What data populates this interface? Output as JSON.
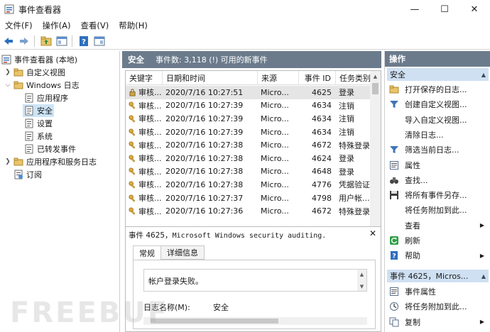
{
  "window": {
    "title": "事件查看器",
    "controls": {
      "minimize": "—",
      "maximize": "☐",
      "close": "✕"
    }
  },
  "menubar": [
    "文件(F)",
    "操作(A)",
    "查看(V)",
    "帮助(H)"
  ],
  "tree": {
    "root": "事件查看器 (本地)",
    "custom_views": "自定义视图",
    "windows_logs": "Windows 日志",
    "logs": [
      "应用程序",
      "安全",
      "设置",
      "系统",
      "已转发事件"
    ],
    "apps_services": "应用程序和服务日志",
    "subscriptions": "订阅"
  },
  "center": {
    "log_name": "安全",
    "log_count": "事件数: 3,118 (!) 可用的新事件",
    "columns": [
      "关键字",
      "日期和时间",
      "来源",
      "事件 ID",
      "任务类别"
    ],
    "rows": [
      [
        "审核...",
        "2020/7/16 10:27:51",
        "Micro...",
        "4625",
        "登录"
      ],
      [
        "审核...",
        "2020/7/16 10:27:39",
        "Micro...",
        "4634",
        "注销"
      ],
      [
        "审核...",
        "2020/7/16 10:27:39",
        "Micro...",
        "4634",
        "注销"
      ],
      [
        "审核...",
        "2020/7/16 10:27:39",
        "Micro...",
        "4634",
        "注销"
      ],
      [
        "审核...",
        "2020/7/16 10:27:38",
        "Micro...",
        "4672",
        "特殊登录"
      ],
      [
        "审核...",
        "2020/7/16 10:27:38",
        "Micro...",
        "4624",
        "登录"
      ],
      [
        "审核...",
        "2020/7/16 10:27:38",
        "Micro...",
        "4648",
        "登录"
      ],
      [
        "审核...",
        "2020/7/16 10:27:38",
        "Micro...",
        "4776",
        "凭据验证"
      ],
      [
        "审核...",
        "2020/7/16 10:27:37",
        "Micro...",
        "4798",
        "用户帐..."
      ],
      [
        "审核...",
        "2020/7/16 10:27:36",
        "Micro...",
        "4672",
        "特殊登录"
      ]
    ]
  },
  "detail": {
    "title_prefix": "事件 4625，",
    "title_mono": "Microsoft Windows security auditing.",
    "tabs": [
      "常规",
      "详细信息"
    ],
    "message": "帐户登录失败。",
    "field_label": "日志名称(M):",
    "field_value": "安全"
  },
  "actions": {
    "title": "操作",
    "section1": "安全",
    "items1": [
      {
        "label": "打开保存的日志...",
        "icon": "folder-icon"
      },
      {
        "label": "创建自定义视图...",
        "icon": "filter-icon"
      },
      {
        "label": "导入自定义视图...",
        "icon": ""
      },
      {
        "label": "清除日志...",
        "icon": ""
      },
      {
        "label": "筛选当前日志...",
        "icon": "filter-icon"
      },
      {
        "label": "属性",
        "icon": "properties-icon"
      },
      {
        "label": "查找...",
        "icon": "binoculars-icon"
      },
      {
        "label": "将所有事件另存...",
        "icon": "save-icon"
      },
      {
        "label": "将任务附加到此...",
        "icon": ""
      },
      {
        "label": "查看",
        "icon": ""
      },
      {
        "label": "刷新",
        "icon": "refresh-icon"
      },
      {
        "label": "帮助",
        "icon": "help-icon"
      }
    ],
    "section2": "事件 4625，Micros...",
    "items2": [
      {
        "label": "事件属性",
        "icon": "properties-icon"
      },
      {
        "label": "将任务附加到此...",
        "icon": "task-icon"
      },
      {
        "label": "复制",
        "icon": "copy-icon"
      }
    ]
  },
  "watermark": "FREEBUF"
}
